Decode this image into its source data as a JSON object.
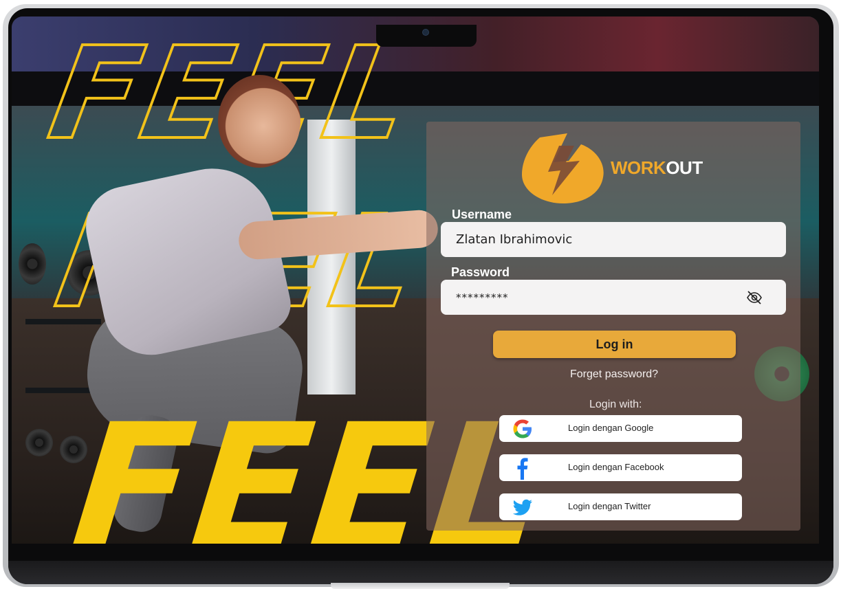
{
  "hero": {
    "word": "FEEL"
  },
  "brand": {
    "prefix": "WORK",
    "suffix": "OUT",
    "accent": "#f0a82a"
  },
  "form": {
    "username_label": "Username",
    "username_value": "Zlatan Ibrahimovic",
    "password_label": "Password",
    "password_value": "*********",
    "login_label": "Log in",
    "forgot_label": "Forget password?",
    "login_with_label": "Login with:"
  },
  "social": [
    {
      "label": "Login dengan Google",
      "icon": "google-icon"
    },
    {
      "label": "Login dengan Facebook",
      "icon": "facebook-icon"
    },
    {
      "label": "Login dengan Twitter",
      "icon": "twitter-icon"
    }
  ],
  "colors": {
    "accent_yellow": "#f6c90e",
    "button": "#e8a93a",
    "panel": "rgba(133,104,96,0.55)"
  }
}
